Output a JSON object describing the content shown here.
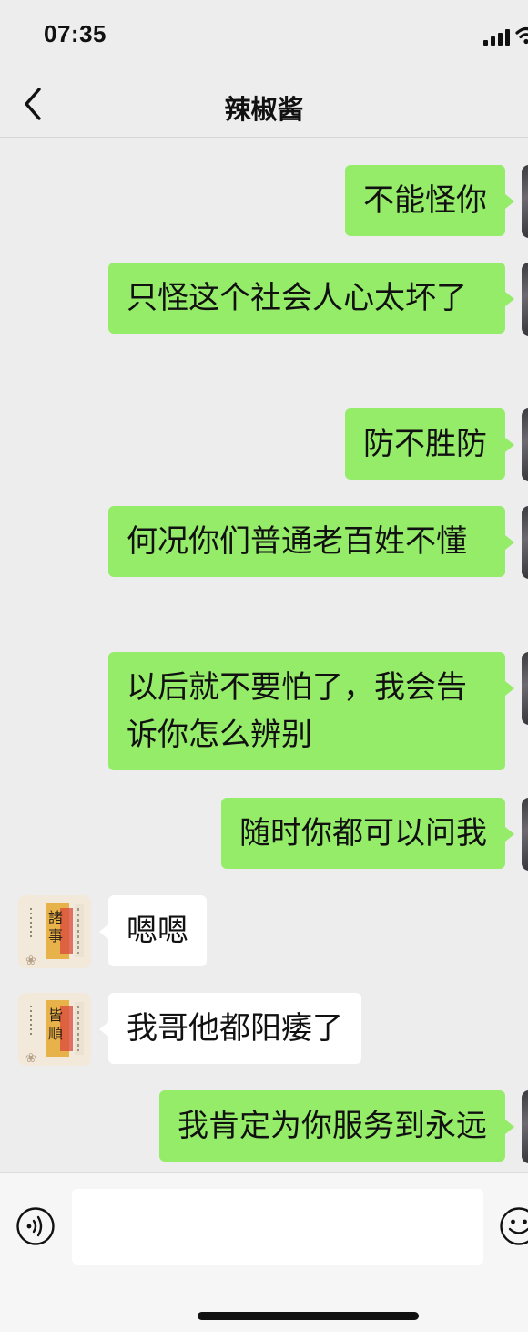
{
  "status_bar": {
    "time": "07:35"
  },
  "chat": {
    "title": "辣椒酱"
  },
  "avatar_text": "諸事皆順",
  "messages": [
    {
      "side": "out",
      "text": "不能怪你"
    },
    {
      "side": "out",
      "text": "只怪这个社会人心太坏了"
    },
    {
      "side": "out",
      "text": "防不胜防"
    },
    {
      "side": "out",
      "text": "何况你们普通老百姓不懂"
    },
    {
      "side": "out",
      "text": "以后就不要怕了，我会告诉你怎么辨别"
    },
    {
      "side": "out",
      "text": "随时你都可以问我"
    },
    {
      "side": "in",
      "text": "嗯嗯"
    },
    {
      "side": "in",
      "text": "我哥他都阳痿了"
    },
    {
      "side": "out",
      "text": "我肯定为你服务到永远"
    }
  ],
  "colors": {
    "outgoing_bubble": "#95ec69",
    "incoming_bubble": "#ffffff",
    "background": "#ededed"
  },
  "icons": {
    "back": "chevron-left-icon",
    "voice": "voice-input-icon",
    "emoji": "emoji-icon",
    "signal": "cellular-signal-icon",
    "wifi": "wifi-icon"
  }
}
